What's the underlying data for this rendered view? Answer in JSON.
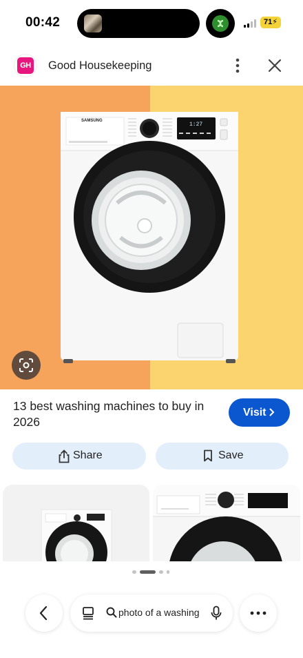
{
  "status_bar": {
    "time": "00:42",
    "battery": "71"
  },
  "site": {
    "logo_text": "GH",
    "name": "Good Housekeeping"
  },
  "hero": {
    "brand_text": "SAMSUNG",
    "display_text": "1:27",
    "left_color": "#f6a35b",
    "right_color": "#fbd36f"
  },
  "result": {
    "title": "13 best washing machines to buy in 2026",
    "visit_label": "Visit"
  },
  "actions": {
    "share_label": "Share",
    "save_label": "Save"
  },
  "pager": {
    "count": 4,
    "active": 1
  },
  "bottom_bar": {
    "search_query": "photo of a washing machine"
  },
  "colors": {
    "accent": "#0b57d0",
    "action_bg": "#e3eefb",
    "logo": "#e8177f"
  },
  "icons": {
    "more": "more-vert-icon",
    "close": "close-icon",
    "lens": "lens-icon",
    "share": "share-icon",
    "save": "bookmark-icon",
    "back": "chevron-left-icon",
    "tabs": "tabs-icon",
    "search": "search-icon",
    "mic": "mic-icon",
    "menu": "more-horiz-icon"
  }
}
